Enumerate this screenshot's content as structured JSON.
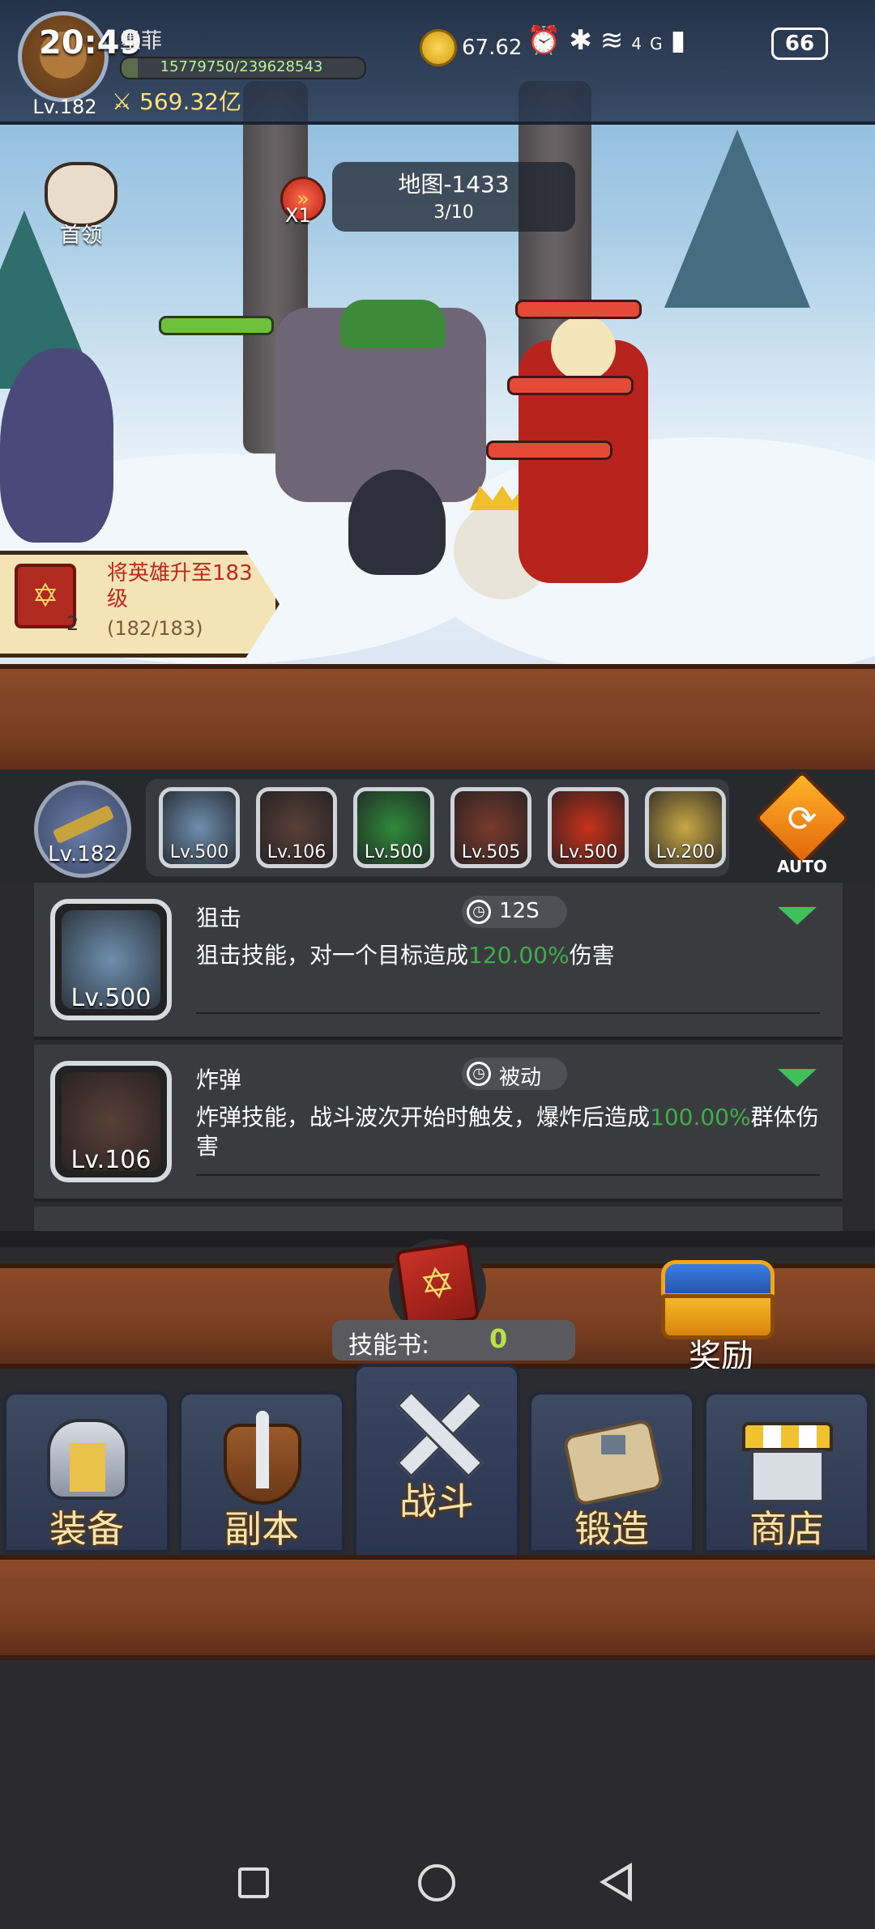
{
  "status_bar": {
    "time": "20:49",
    "network": "4G",
    "battery": "66"
  },
  "player": {
    "name": "墨菲",
    "level": "Lv.182",
    "exp_text": "15779750/239628543",
    "exp_fraction": 0.066,
    "power": "569.32亿",
    "gold": "67.62"
  },
  "battle": {
    "boss_label": "首领",
    "speed_label": "X1",
    "map_name": "地图-1433",
    "wave": "3/10"
  },
  "quest": {
    "book_count": "2",
    "title": "将英雄升至183级",
    "progress": "(182/183)"
  },
  "weapon": {
    "level": "Lv.182"
  },
  "skills_bar": [
    {
      "level": "Lv.500",
      "color": "#6e8fae"
    },
    {
      "level": "Lv.106",
      "color": "#5a4038"
    },
    {
      "level": "Lv.500",
      "color": "#2f8a3a"
    },
    {
      "level": "Lv.505",
      "color": "#7a3a2c"
    },
    {
      "level": "Lv.500",
      "color": "#c8321a"
    },
    {
      "level": "Lv.200",
      "color": "#c9a844"
    }
  ],
  "auto_label": "AUTO",
  "skill_list": [
    {
      "name": "狙击",
      "cooldown": "12S",
      "desc_before": "狙击技能，对一个目标造成",
      "desc_value": "120.00%",
      "desc_after": "伤害",
      "level": "Lv.500",
      "color": "#6e8fae"
    },
    {
      "name": "炸弹",
      "cooldown": "被动",
      "desc_before": "炸弹技能，战斗波次开始时触发，爆炸后造成",
      "desc_value": "100.00%",
      "desc_after": "群体伤害",
      "level": "Lv.106",
      "color": "#5a4038"
    }
  ],
  "skill_book": {
    "label": "技能书:",
    "count": "0"
  },
  "reward_label": "奖励",
  "nav_tabs": [
    {
      "label": "装备",
      "icon": "helmet-icon"
    },
    {
      "label": "副本",
      "icon": "sword-shield-icon"
    },
    {
      "label": "战斗",
      "icon": "crossed-swords-icon"
    },
    {
      "label": "锻造",
      "icon": "hammer-scroll-icon"
    },
    {
      "label": "商店",
      "icon": "shop-icon"
    }
  ],
  "colors": {
    "wood": "#7a3f22",
    "panel": "#3a3b3f",
    "highlight_green": "#3fae4a",
    "hp_green": "#6cc33b",
    "hp_red": "#e44a36"
  }
}
